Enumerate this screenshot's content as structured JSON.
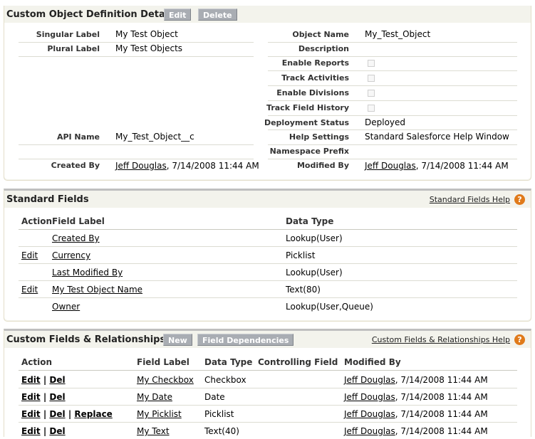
{
  "detail": {
    "title": "Custom Object Definition Detail",
    "edit_btn": "Edit",
    "delete_btn": "Delete",
    "left": {
      "singular_label": {
        "label": "Singular Label",
        "value": "My Test Object"
      },
      "plural_label": {
        "label": "Plural Label",
        "value": "My Test Objects"
      },
      "api_name": {
        "label": "API Name",
        "value": "My_Test_Object__c"
      },
      "created_by": {
        "label": "Created By",
        "user": "Jeff Douglas",
        "date": ", 7/14/2008 11:44 AM"
      }
    },
    "right": {
      "object_name": {
        "label": "Object Name",
        "value": "My_Test_Object"
      },
      "description": {
        "label": "Description",
        "value": ""
      },
      "enable_reports": {
        "label": "Enable Reports"
      },
      "track_activities": {
        "label": "Track Activities"
      },
      "enable_divisions": {
        "label": "Enable Divisions"
      },
      "track_field_history": {
        "label": "Track Field History"
      },
      "deployment_status": {
        "label": "Deployment Status",
        "value": "Deployed"
      },
      "help_settings": {
        "label": "Help Settings",
        "value": "Standard Salesforce Help Window"
      },
      "namespace_prefix": {
        "label": "Namespace Prefix",
        "value": ""
      },
      "modified_by": {
        "label": "Modified By",
        "user": "Jeff Douglas",
        "date": ", 7/14/2008 11:44 AM"
      }
    }
  },
  "standard": {
    "title": "Standard Fields",
    "help_link": "Standard Fields Help",
    "headers": {
      "action": "Action",
      "field_label": "Field Label",
      "data_type": "Data Type"
    },
    "rows": [
      {
        "action": "",
        "label": "Created By",
        "type": "Lookup(User)"
      },
      {
        "action": "Edit",
        "label": "Currency",
        "type": "Picklist"
      },
      {
        "action": "",
        "label": "Last Modified By",
        "type": "Lookup(User)"
      },
      {
        "action": "Edit",
        "label": "My Test Object Name",
        "type": "Text(80)"
      },
      {
        "action": "",
        "label": "Owner",
        "type": "Lookup(User,Queue)"
      }
    ]
  },
  "custom": {
    "title": "Custom Fields & Relationships",
    "new_btn": "New",
    "deps_btn": "Field Dependencies",
    "help_link": "Custom Fields & Relationships Help",
    "headers": {
      "action": "Action",
      "field_label": "Field Label",
      "data_type": "Data Type",
      "controlling": "Controlling Field",
      "modified_by": "Modified By"
    },
    "sep": "|",
    "edit": "Edit",
    "del": "Del",
    "replace": "Replace",
    "rows": [
      {
        "label": "My Checkbox",
        "type": "Checkbox",
        "user": "Jeff Douglas",
        "date": ", 7/14/2008 11:44 AM"
      },
      {
        "label": "My Date",
        "type": "Date",
        "user": "Jeff Douglas",
        "date": ", 7/14/2008 11:44 AM"
      },
      {
        "label": "My Picklist",
        "type": "Picklist",
        "user": "Jeff Douglas",
        "date": ", 7/14/2008 11:44 AM"
      },
      {
        "label": "My Text",
        "type": "Text(40)",
        "user": "Jeff Douglas",
        "date": ", 7/14/2008 11:44 AM"
      }
    ]
  }
}
